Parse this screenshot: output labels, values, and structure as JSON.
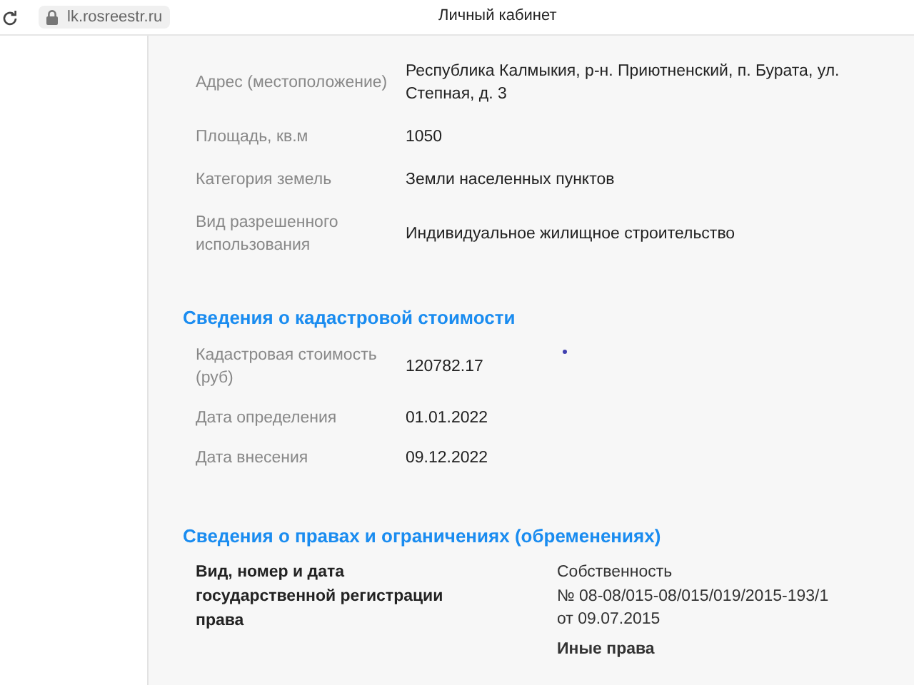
{
  "browser": {
    "url": "lk.rosreestr.ru",
    "title": "Личный кабинет"
  },
  "object_rows": [
    {
      "label": "Адрес (местоположение)",
      "value": "Республика Калмыкия, р-н. Приютненский, п. Бурата, ул. Степная, д. 3"
    },
    {
      "label": "Площадь, кв.м",
      "value": "1050"
    },
    {
      "label": "Категория земель",
      "value": "Земли населенных пунктов"
    },
    {
      "label": "Вид разрешенного использования",
      "value": "Индивидуальное жилищное строительство"
    }
  ],
  "cost_section": {
    "title": "Сведения о кадастровой стоимости",
    "rows": [
      {
        "label": "Кадастровая стоимость (руб)",
        "value": "120782.17"
      },
      {
        "label": "Дата определения",
        "value": "01.01.2022"
      },
      {
        "label": "Дата внесения",
        "value": "09.12.2022"
      }
    ]
  },
  "rights_section": {
    "title": "Сведения о правах и ограничениях (обременениях)",
    "label": "Вид, номер и дата государственной регистрации права",
    "entries": [
      {
        "kind": "plain",
        "text": "Собственность"
      },
      {
        "kind": "plain",
        "text": "№ 08-08/015-08/015/019/2015-193/1"
      },
      {
        "kind": "plain",
        "text": "от 09.07.2015"
      },
      {
        "kind": "heading",
        "text": "Иные права"
      }
    ]
  }
}
